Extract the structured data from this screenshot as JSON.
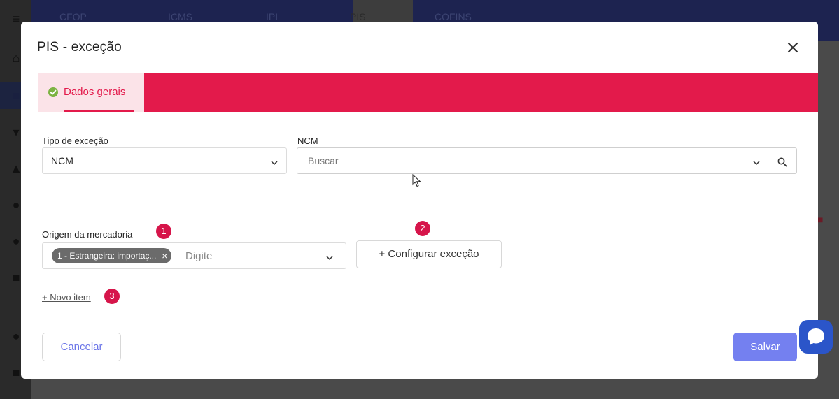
{
  "background": {
    "tabs": [
      "CFOP",
      "ICMS",
      "IPI",
      "PIS",
      "COFINS"
    ]
  },
  "modal": {
    "title": "PIS - exceção",
    "tabs": [
      {
        "label": "Dados gerais",
        "active": true
      }
    ],
    "tipo_excecao": {
      "label": "Tipo de exceção",
      "value": "NCM"
    },
    "ncm": {
      "label": "NCM",
      "placeholder": "Buscar"
    },
    "origem": {
      "label": "Origem da mercadoria",
      "badge": "1",
      "chip": "1 - Estrangeira: importaç...",
      "placeholder": "Digite"
    },
    "configurar": {
      "badge": "2",
      "label": "+ Configurar exceção"
    },
    "novo_item": {
      "label": "+ Novo item",
      "badge": "3"
    },
    "cancel_label": "Cancelar",
    "save_label": "Salvar"
  },
  "colors": {
    "accent": "#e31a4b",
    "primary": "#7480f0",
    "badge": "#d6154a"
  }
}
